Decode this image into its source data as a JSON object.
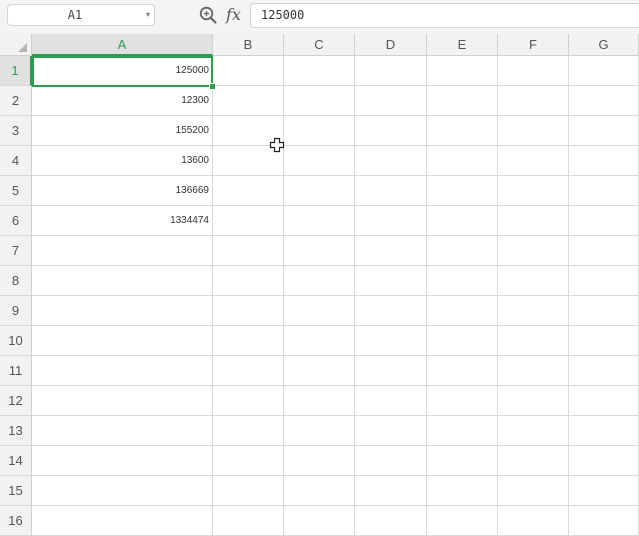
{
  "formula_bar": {
    "name_box": "A1",
    "name_box_arrow": "▾",
    "fx_label": "fx",
    "formula_value": "125000"
  },
  "columns": [
    "A",
    "B",
    "C",
    "D",
    "E",
    "F",
    "G"
  ],
  "rows": [
    "1",
    "2",
    "3",
    "4",
    "5",
    "6",
    "7",
    "8",
    "9",
    "10",
    "11",
    "12",
    "13",
    "14",
    "15",
    "16"
  ],
  "cells": {
    "A1": "125000",
    "A2": "12300",
    "A3": "155200",
    "A4": "13600",
    "A5": "136669",
    "A6": "1334474"
  },
  "selection": {
    "active_cell": "A1",
    "active_column": "A",
    "active_row": "1"
  },
  "colors": {
    "accent": "#2e9c4f",
    "header_bg": "#f2f2f2",
    "grid_line": "#dadada"
  },
  "icons": {
    "zoom": "zoom-formula-icon",
    "corner": "select-all-icon",
    "cursor": "cell-cursor-icon"
  }
}
